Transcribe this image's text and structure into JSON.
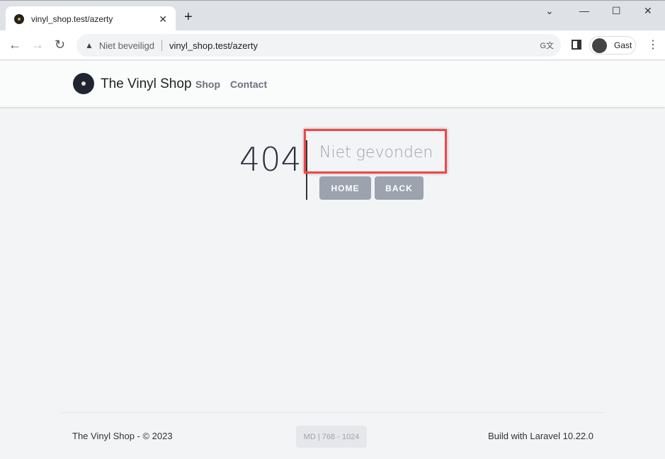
{
  "browser": {
    "tab_title": "vinyl_shop.test/azerty",
    "security_label": "Niet beveiligd",
    "url": "vinyl_shop.test/azerty",
    "profile_label": "Gast"
  },
  "site": {
    "brand": "The Vinyl Shop",
    "nav": [
      "Shop",
      "Contact"
    ]
  },
  "error": {
    "code": "404",
    "message": "Niet gevonden",
    "buttons": [
      "HOME",
      "BACK"
    ],
    "highlight_color": "#f04848"
  },
  "footer": {
    "copyright": "The Vinyl Shop - © 2023",
    "breakpoint": "MD | 768 - 1024",
    "build": "Build with Laravel 10.22.0"
  }
}
